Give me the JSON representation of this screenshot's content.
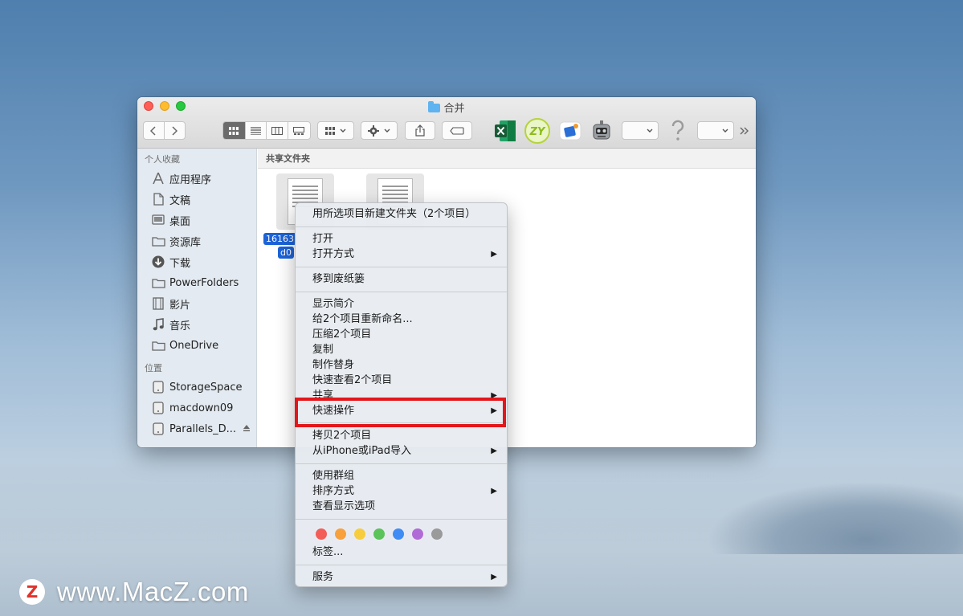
{
  "window": {
    "title": "合并",
    "path_bar": "共享文件夹"
  },
  "sidebar": {
    "favorites_header": "个人收藏",
    "favorites": [
      {
        "label": "应用程序",
        "icon": "applications-icon"
      },
      {
        "label": "文稿",
        "icon": "documents-icon"
      },
      {
        "label": "桌面",
        "icon": "desktop-icon"
      },
      {
        "label": "资源库",
        "icon": "folder-icon"
      },
      {
        "label": "下载",
        "icon": "downloads-icon"
      },
      {
        "label": "PowerFolders",
        "icon": "folder-icon"
      },
      {
        "label": "影片",
        "icon": "movies-icon"
      },
      {
        "label": "音乐",
        "icon": "music-icon"
      },
      {
        "label": "OneDrive",
        "icon": "folder-icon"
      }
    ],
    "locations_header": "位置",
    "locations": [
      {
        "label": "StorageSpace",
        "icon": "disk-icon"
      },
      {
        "label": "macdown09",
        "icon": "disk-icon"
      },
      {
        "label": "Parallels_D...",
        "icon": "disk-icon"
      }
    ]
  },
  "files": {
    "file1_label_line1": "16163",
    "file1_label_line2": "d0"
  },
  "context_menu": {
    "new_folder": "用所选项目新建文件夹（2个项目）",
    "open": "打开",
    "open_with": "打开方式",
    "trash": "移到废纸篓",
    "get_info": "显示简介",
    "rename": "给2个项目重新命名...",
    "compress": "压缩2个项目",
    "duplicate": "复制",
    "alias": "制作替身",
    "quick_look": "快速查看2个项目",
    "share": "共享",
    "quick_actions": "快速操作",
    "copy": "拷贝2个项目",
    "import": "从iPhone或iPad导入",
    "use_groups": "使用群组",
    "sort_by": "排序方式",
    "view_options": "查看显示选项",
    "tags": "标签...",
    "services": "服务",
    "tag_colors": [
      "#f35d58",
      "#f7a03c",
      "#f8cd3d",
      "#5ac35a",
      "#3f8cf4",
      "#b16bd6",
      "#9a9a9a"
    ]
  },
  "highlight_color": "#e3161b",
  "watermark": {
    "logo": "Z",
    "text": "www.MacZ.com"
  }
}
